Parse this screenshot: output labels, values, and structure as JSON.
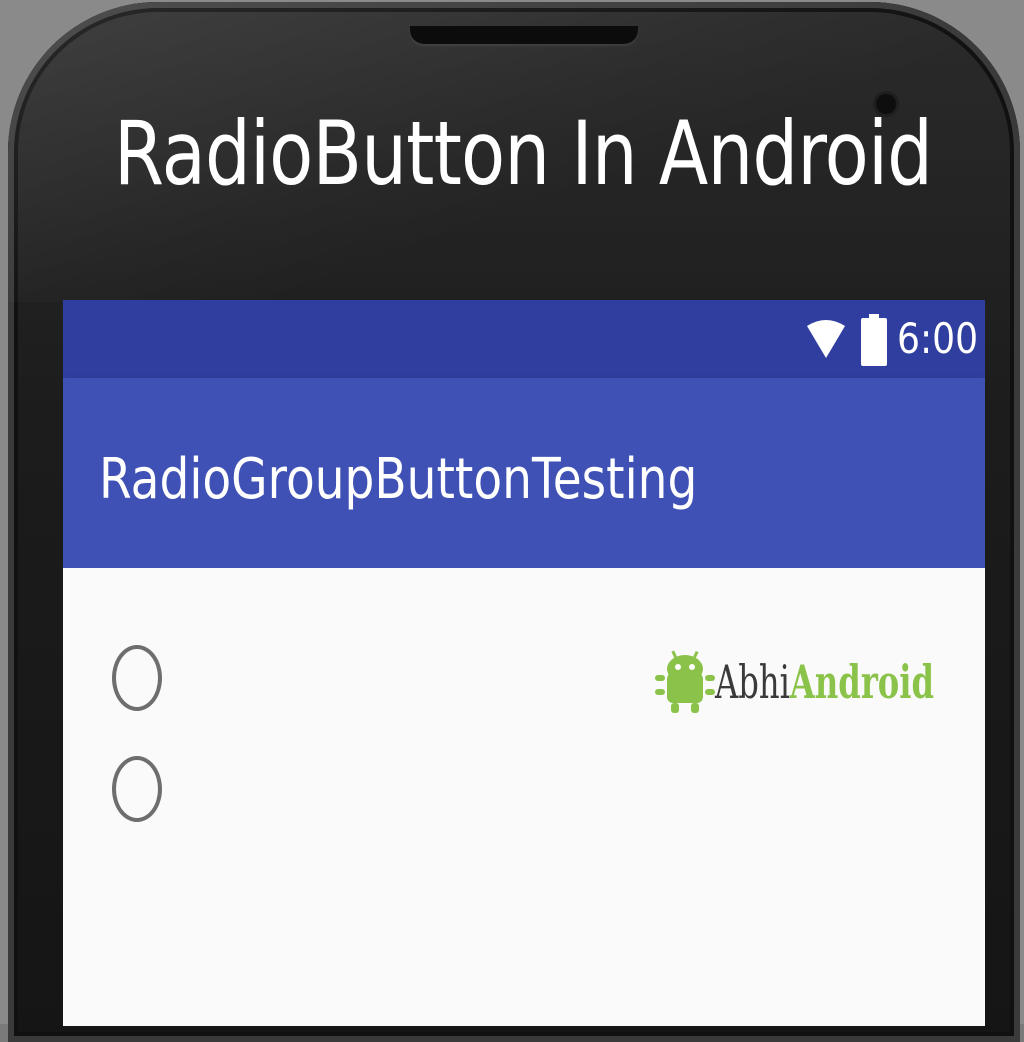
{
  "headline": "RadioButton In Android",
  "status_bar": {
    "time": "6:00",
    "icons": [
      "wifi-icon",
      "battery-icon"
    ]
  },
  "app_bar": {
    "title": "RadioGroupButtonTesting"
  },
  "radio_group": {
    "buttons": [
      {
        "label": "",
        "checked": false
      },
      {
        "label": "",
        "checked": false
      }
    ]
  },
  "logo": {
    "text_part1": "Abhi",
    "text_part2": "Android",
    "icon": "android-bug-icon"
  },
  "colors": {
    "status_bar": "#303f9f",
    "app_bar": "#3f51b5",
    "content_bg": "#fafafa",
    "radio_border": "#6e6e6e",
    "logo_green": "#8bc34a"
  }
}
